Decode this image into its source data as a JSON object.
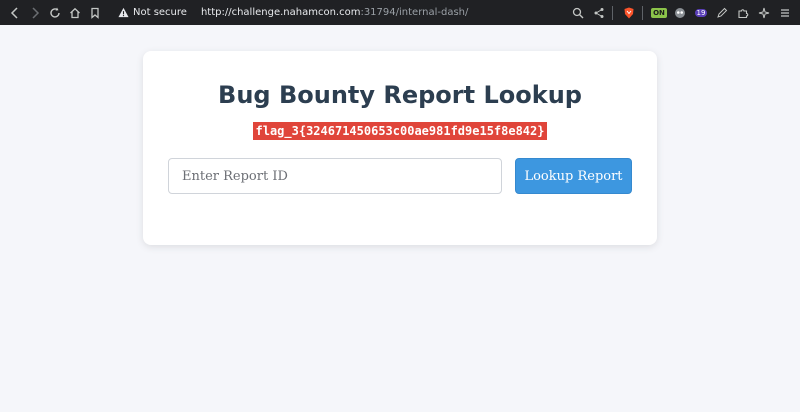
{
  "browser": {
    "security_label": "Not secure",
    "url_host": "http://challenge.nahamcon.com",
    "url_rest": ":31794/internal-dash/",
    "extension_badge_text": "ON",
    "notification_count": "19"
  },
  "page": {
    "title": "Bug Bounty Report Lookup",
    "flag": "flag_3{324671450653c00ae981fd9e15f8e842}",
    "input_placeholder": "Enter Report ID",
    "input_value": "",
    "button_label": "Lookup Report"
  },
  "colors": {
    "chrome_bg": "#202124",
    "page_bg": "#f5f6fa",
    "title_color": "#2c3e50",
    "flag_bg": "#e0453a",
    "button_bg": "#3d97e0"
  }
}
